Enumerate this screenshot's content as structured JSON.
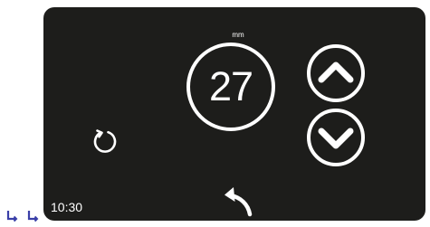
{
  "display": {
    "unit": "mm",
    "value": "27",
    "time": "10:30"
  },
  "controls": {
    "increase_icon": "chevron-up-icon",
    "decrease_icon": "chevron-down-icon",
    "refresh_icon": "refresh-icon",
    "back_icon": "back-arrow-icon"
  },
  "colors": {
    "panel_background": "#1d1d1b",
    "foreground": "#ffffff",
    "corner_icon": "#3a3fa8"
  }
}
